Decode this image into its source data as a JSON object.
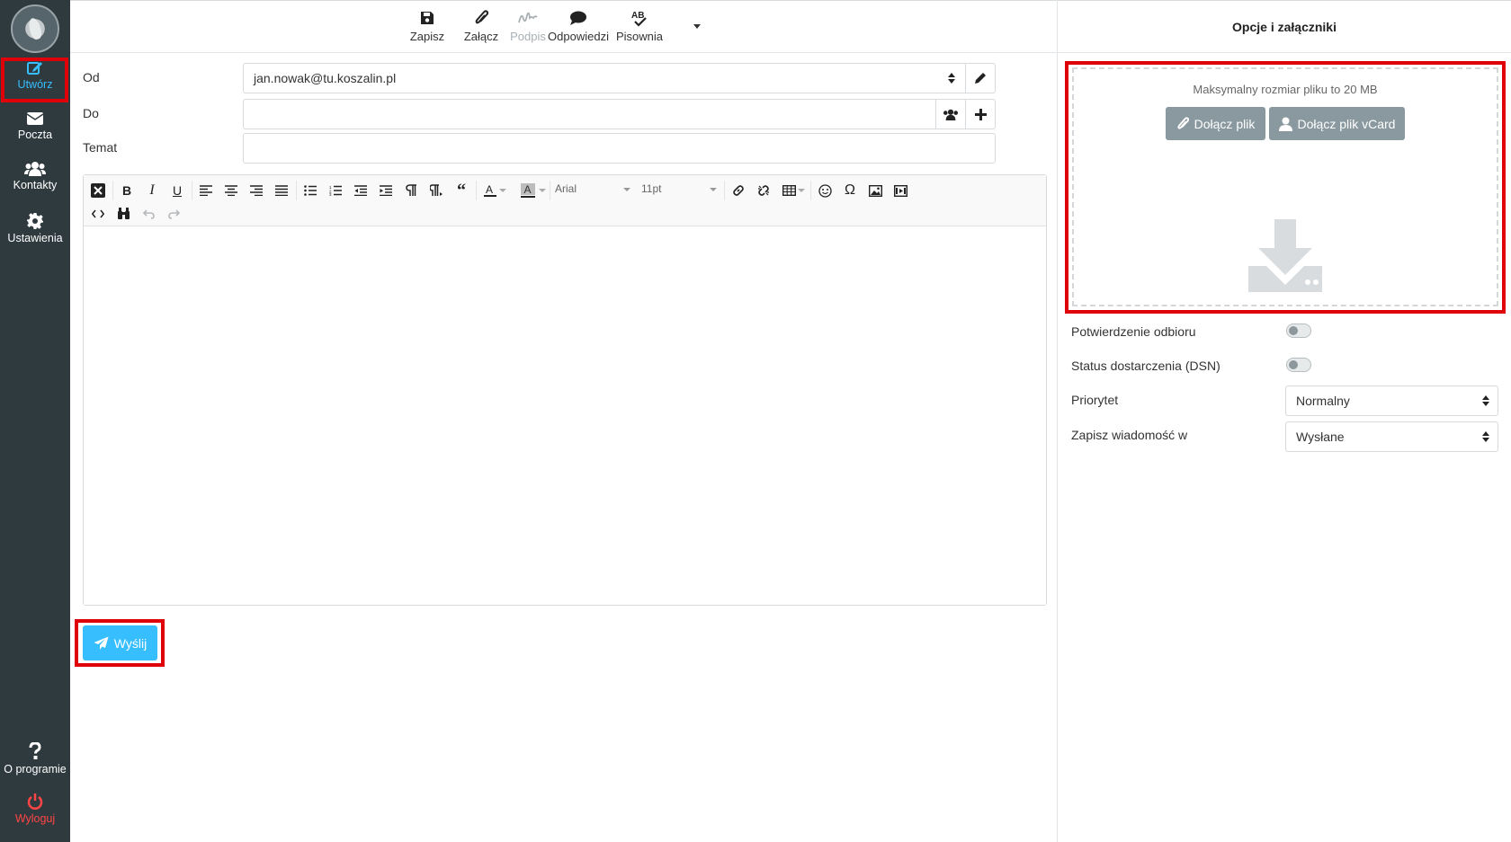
{
  "sidebar": {
    "compose": "Utwórz",
    "mail": "Poczta",
    "contacts": "Kontakty",
    "settings": "Ustawienia",
    "about": "O programie",
    "logout": "Wyloguj"
  },
  "toolbar": {
    "save": "Zapisz",
    "attach": "Załącz",
    "signature": "Podpis",
    "responses": "Odpowiedzi",
    "spell": "Pisownia"
  },
  "form": {
    "from_label": "Od",
    "from_value": "jan.nowak@tu.koszalin.pl",
    "to_label": "Do",
    "to_value": "",
    "subject_label": "Temat",
    "subject_value": ""
  },
  "editor": {
    "font_family": "Arial",
    "font_size": "11pt"
  },
  "send_label": "Wyślij",
  "right_panel": {
    "title": "Opcje i załączniki",
    "max_size": "Maksymalny rozmiar pliku to 20 MB",
    "attach_file": "Dołącz plik",
    "attach_vcard": "Dołącz plik vCard",
    "read_receipt": "Potwierdzenie odbioru",
    "dsn": "Status dostarczenia (DSN)",
    "priority_label": "Priorytet",
    "priority_value": "Normalny",
    "save_in_label": "Zapisz wiadomość w",
    "save_in_value": "Wysłane"
  },
  "colors": {
    "sidebar_bg": "#2f3a3f",
    "accent": "#37beff",
    "logout": "#ff4545",
    "highlight": "#e00009",
    "button_gray": "#8a999f"
  }
}
